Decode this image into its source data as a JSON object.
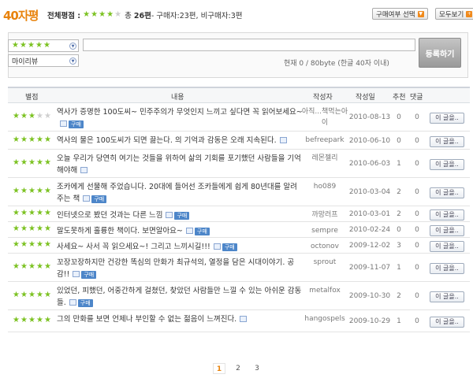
{
  "header": {
    "logo": "40자평",
    "overall_label": "전체평점 :",
    "total_prefix": "총",
    "total_count": "26편",
    "buyer_text": " - 구매자:23편, 비구매자:3편",
    "overall_rating": 4,
    "buy_filter_button": "구매여부 선택",
    "view_all_button": "모두보기"
  },
  "write": {
    "rating_select": 5,
    "type_select": "마이리뷰",
    "input_value": "",
    "counter": "현재 0 / 80byte (한글 40자 이내)",
    "submit_label": "등록하기"
  },
  "table": {
    "columns": [
      "별점",
      "내용",
      "작성자",
      "작성일",
      "추천",
      "댓글"
    ],
    "more_label": "이 글을..",
    "rows": [
      {
        "stars": 3,
        "text": "역사가 증명한 100도씨~ 민주주의가 무엇인지 느끼고 싶다면 꼭 읽어보세요~",
        "buy": true,
        "author": "아직...책먹는아이",
        "date": "2010-08-13",
        "rec": "0",
        "cmt": "0"
      },
      {
        "stars": 5,
        "text": "역사의 물은 100도씨가 되면 끓는다. 의 기억과 감동은 오래 지속된다.",
        "buy": false,
        "author": "befreepark",
        "date": "2010-06-10",
        "rec": "0",
        "cmt": "0"
      },
      {
        "stars": 5,
        "text": "오늘 우리가 당연히 여기는 것들을 위하여 삶의 기회를 포기했던 사람들을 기억해야해",
        "buy": false,
        "author": "레몬젤리",
        "date": "2010-06-03",
        "rec": "1",
        "cmt": "0"
      },
      {
        "stars": 5,
        "text": "조카에게 선물해 주었습니다. 20대에 들어선 조카들에게 쉽게 80년대를 알려주는 책",
        "buy": true,
        "author": "ho089",
        "date": "2010-03-04",
        "rec": "2",
        "cmt": "0"
      },
      {
        "stars": 5,
        "text": "인터넷으로 봤던 것과는 다른 느낌",
        "buy": true,
        "author": "까망러프",
        "date": "2010-03-01",
        "rec": "2",
        "cmt": "0"
      },
      {
        "stars": 5,
        "text": "말도못하게 훌륭한 책이다. 보면알아요~",
        "buy": true,
        "author": "sempre",
        "date": "2010-02-24",
        "rec": "0",
        "cmt": "0"
      },
      {
        "stars": 5,
        "text": "사세요~ 사서 꼭 읽으세요~! 그리고 느끼시길!!!",
        "buy": true,
        "author": "octonov",
        "date": "2009-12-02",
        "rec": "3",
        "cmt": "0"
      },
      {
        "stars": 5,
        "text": "꼬장꼬장하지만 건강한 똑심의 만화가 최규석의, 열정을 담은 시대이야기. 공감!!",
        "buy": true,
        "author": "sprout",
        "date": "2009-11-07",
        "rec": "1",
        "cmt": "0"
      },
      {
        "stars": 5,
        "text": "있었던, 피했던, 어중간하게 걸쳤던, 찾았던 사람들만 느낄 수 있는 아쉬운 감동들.",
        "buy": true,
        "author": "metalfox",
        "date": "2009-10-30",
        "rec": "2",
        "cmt": "0"
      },
      {
        "stars": 5,
        "text": "그의 만화를 보면 언제나 부인할 수 없는 젊음이 느껴진다.",
        "buy": false,
        "author": "hangospels",
        "date": "2009-10-29",
        "rec": "1",
        "cmt": "0"
      }
    ]
  },
  "pagination": {
    "pages": [
      "1",
      "2",
      "3"
    ],
    "current": "1"
  },
  "colors": {
    "accent": "#e8830c",
    "star": "#7cc222",
    "badge": "#4d86c9"
  }
}
